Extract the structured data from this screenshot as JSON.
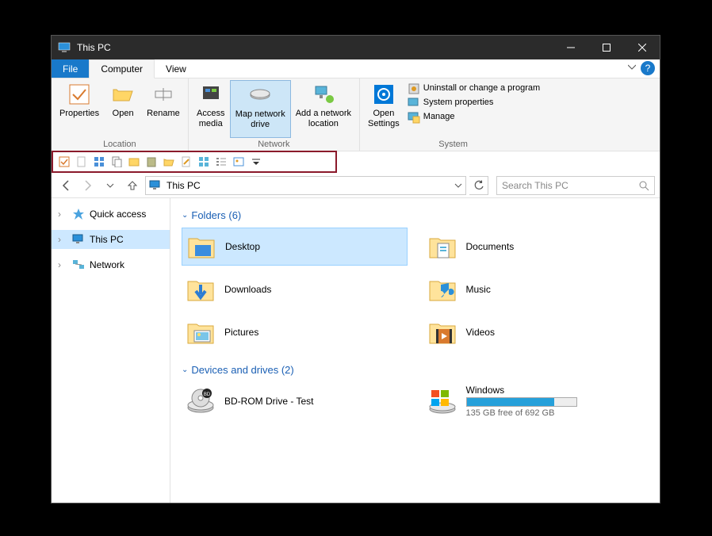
{
  "window": {
    "title": "This PC"
  },
  "tabs": {
    "file": "File",
    "computer": "Computer",
    "view": "View"
  },
  "ribbon": {
    "location": {
      "properties": "Properties",
      "open": "Open",
      "rename": "Rename",
      "label": "Location"
    },
    "network": {
      "access_media": "Access\nmedia",
      "map_drive": "Map network\ndrive",
      "add_location": "Add a network\nlocation",
      "label": "Network"
    },
    "system": {
      "open_settings": "Open\nSettings",
      "uninstall": "Uninstall or change a program",
      "sysprops": "System properties",
      "manage": "Manage",
      "label": "System"
    }
  },
  "addressbar": {
    "path": "This PC"
  },
  "search": {
    "placeholder": "Search This PC"
  },
  "sidebar": {
    "quick_access": "Quick access",
    "this_pc": "This PC",
    "network": "Network"
  },
  "sections": {
    "folders": {
      "label": "Folders",
      "count": "(6)"
    },
    "devices": {
      "label": "Devices and drives",
      "count": "(2)"
    }
  },
  "folders": [
    {
      "name": "Desktop"
    },
    {
      "name": "Documents"
    },
    {
      "name": "Downloads"
    },
    {
      "name": "Music"
    },
    {
      "name": "Pictures"
    },
    {
      "name": "Videos"
    }
  ],
  "drives": [
    {
      "name": "BD-ROM Drive - Test"
    },
    {
      "name": "Windows",
      "free": "135 GB free of 692 GB",
      "pct": 80
    }
  ]
}
